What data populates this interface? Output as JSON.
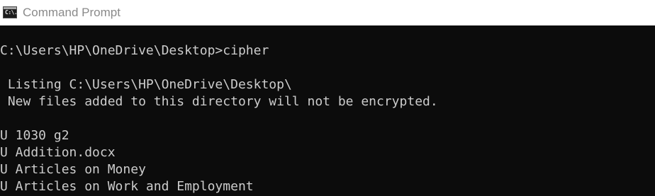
{
  "window": {
    "title": "Command Prompt",
    "icon_text": "C:\\."
  },
  "console": {
    "lines": [
      "C:\\Users\\HP\\OneDrive\\Desktop>cipher",
      " Listing C:\\Users\\HP\\OneDrive\\Desktop\\",
      " New files added to this directory will not be encrypted.",
      "U 1030 g2",
      "U Addition.docx",
      "U Articles on Money",
      "U Articles on Work and Employment"
    ]
  },
  "colors": {
    "console_background": "#0c0c0c",
    "console_text": "#cccccc",
    "titlebar_background": "#ffffff",
    "title_text": "#8a8a8a"
  }
}
